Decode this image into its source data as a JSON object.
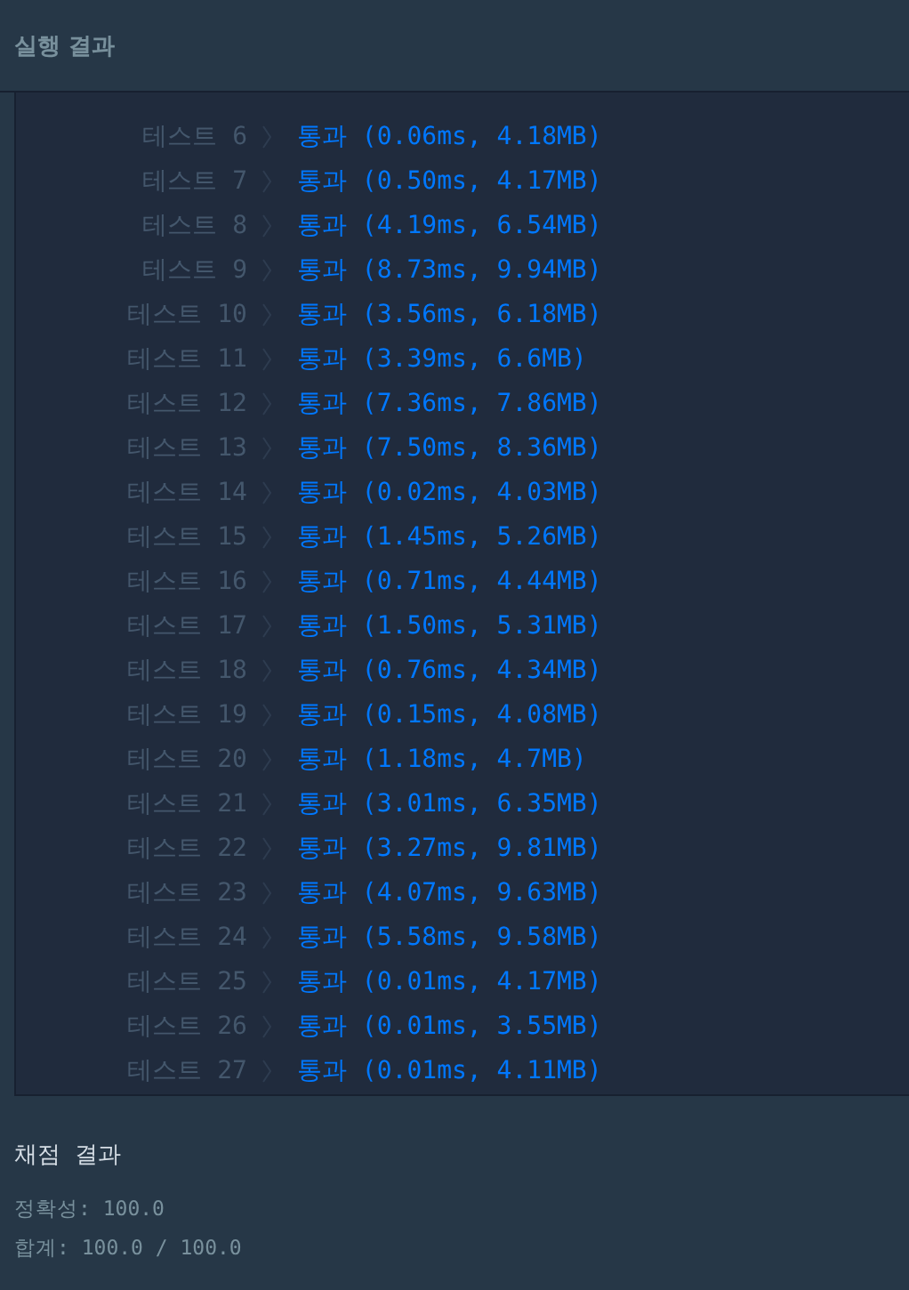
{
  "header": {
    "title": "실행 결과"
  },
  "tests": [
    {
      "label": "테스트 6",
      "result": "통과",
      "detail": "(0.06ms, 4.18MB)"
    },
    {
      "label": "테스트 7",
      "result": "통과",
      "detail": "(0.50ms, 4.17MB)"
    },
    {
      "label": "테스트 8",
      "result": "통과",
      "detail": "(4.19ms, 6.54MB)"
    },
    {
      "label": "테스트 9",
      "result": "통과",
      "detail": "(8.73ms, 9.94MB)"
    },
    {
      "label": "테스트 10",
      "result": "통과",
      "detail": "(3.56ms, 6.18MB)"
    },
    {
      "label": "테스트 11",
      "result": "통과",
      "detail": "(3.39ms, 6.6MB)"
    },
    {
      "label": "테스트 12",
      "result": "통과",
      "detail": "(7.36ms, 7.86MB)"
    },
    {
      "label": "테스트 13",
      "result": "통과",
      "detail": "(7.50ms, 8.36MB)"
    },
    {
      "label": "테스트 14",
      "result": "통과",
      "detail": "(0.02ms, 4.03MB)"
    },
    {
      "label": "테스트 15",
      "result": "통과",
      "detail": "(1.45ms, 5.26MB)"
    },
    {
      "label": "테스트 16",
      "result": "통과",
      "detail": "(0.71ms, 4.44MB)"
    },
    {
      "label": "테스트 17",
      "result": "통과",
      "detail": "(1.50ms, 5.31MB)"
    },
    {
      "label": "테스트 18",
      "result": "통과",
      "detail": "(0.76ms, 4.34MB)"
    },
    {
      "label": "테스트 19",
      "result": "통과",
      "detail": "(0.15ms, 4.08MB)"
    },
    {
      "label": "테스트 20",
      "result": "통과",
      "detail": "(1.18ms, 4.7MB)"
    },
    {
      "label": "테스트 21",
      "result": "통과",
      "detail": "(3.01ms, 6.35MB)"
    },
    {
      "label": "테스트 22",
      "result": "통과",
      "detail": "(3.27ms, 9.81MB)"
    },
    {
      "label": "테스트 23",
      "result": "통과",
      "detail": "(4.07ms, 9.63MB)"
    },
    {
      "label": "테스트 24",
      "result": "통과",
      "detail": "(5.58ms, 9.58MB)"
    },
    {
      "label": "테스트 25",
      "result": "통과",
      "detail": "(0.01ms, 4.17MB)"
    },
    {
      "label": "테스트 26",
      "result": "통과",
      "detail": "(0.01ms, 3.55MB)"
    },
    {
      "label": "테스트 27",
      "result": "통과",
      "detail": "(0.01ms, 4.11MB)"
    }
  ],
  "grading": {
    "title": "채점 결과",
    "lines": [
      "정확성: 100.0",
      "합계: 100.0 / 100.0"
    ]
  }
}
